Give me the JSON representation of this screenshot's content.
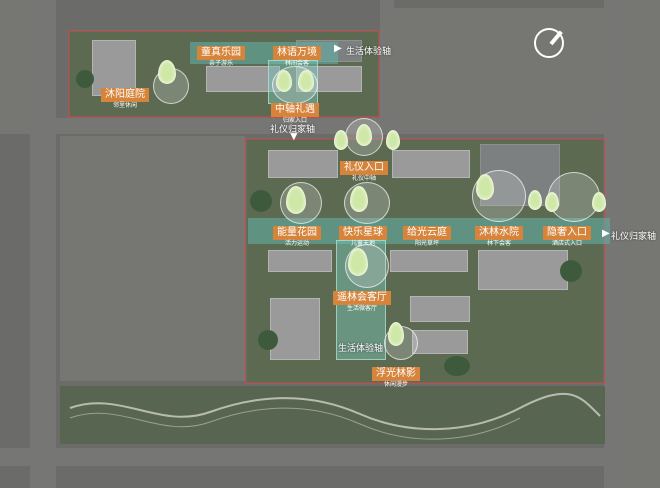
{
  "nodes": [
    {
      "id": "tongzhen",
      "title": "童真乐园",
      "sub": "亲子游乐"
    },
    {
      "id": "linyu",
      "title": "林语万境",
      "sub": "林间会客"
    },
    {
      "id": "muyang",
      "title": "沐阳庭院",
      "sub": "邻里休闲"
    },
    {
      "id": "zhongzhou",
      "title": "中轴礼遇",
      "sub": "归家入口"
    },
    {
      "id": "liyi",
      "title": "礼仪入口",
      "sub": "礼仪中轴"
    },
    {
      "id": "nengliang",
      "title": "能量花园",
      "sub": "活力运动"
    },
    {
      "id": "kuaile",
      "title": "快乐星球",
      "sub": "儿童天地"
    },
    {
      "id": "geguang",
      "title": "给光云庭",
      "sub": "阳光草坪"
    },
    {
      "id": "mulin",
      "title": "沐林水院",
      "sub": "林下会客"
    },
    {
      "id": "yinshe",
      "title": "隐奢入口",
      "sub": "酒店式入口"
    },
    {
      "id": "yaolin",
      "title": "遥林会客厅",
      "sub": "生活微客厅"
    },
    {
      "id": "fuguang",
      "title": "浮光林影",
      "sub": "休闲漫步"
    }
  ],
  "tags": {
    "life_axis_top": "生活体验轴",
    "ceremony_axis_top": "礼仪归家轴",
    "life_axis_bottom": "生活体验轴",
    "ceremony_axis_right": "礼仪归家轴"
  },
  "colors": {
    "label_bg": "#d6843b",
    "axis": "#60b2a8",
    "site_line": "#c64b42"
  },
  "icons": {
    "compass": "compass-icon",
    "arrow": "arrow-right-icon",
    "tree_marker": "tree-marker-icon"
  }
}
